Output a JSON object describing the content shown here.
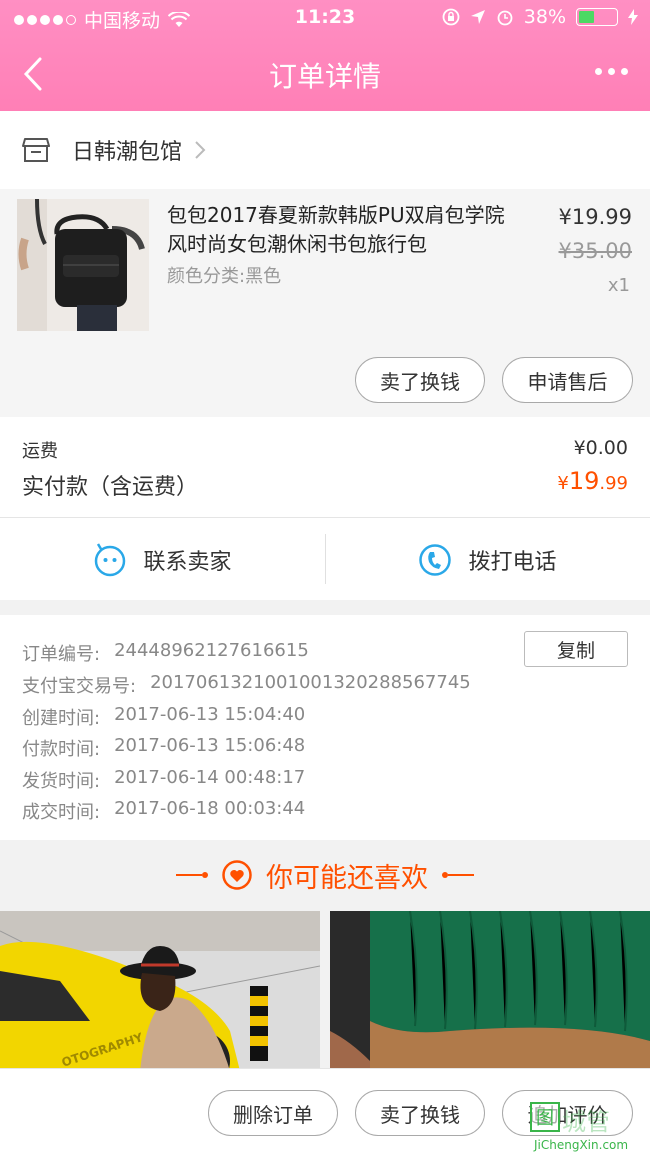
{
  "status_bar": {
    "carrier": "中国移动",
    "time": "11:23",
    "battery": "38%",
    "battery_level": 0.38
  },
  "nav": {
    "title": "订单详情"
  },
  "shop": {
    "name": "日韩潮包馆"
  },
  "product": {
    "name": "包包2017春夏新款韩版PU双肩包学院风时尚女包潮休闲书包旅行包",
    "spec": "颜色分类:黑色",
    "price": "¥19.99",
    "original_price": "¥35.00",
    "quantity": "x1",
    "sell_button": "卖了换钱",
    "after_sale_button": "申请售后"
  },
  "fees": {
    "shipping_label": "运费",
    "shipping_value": "¥0.00",
    "paid_label": "实付款（含运费）",
    "paid_currency": "¥",
    "paid_int": "19",
    "paid_dec": ".99"
  },
  "contact": {
    "seller_label": "联系卖家",
    "call_label": "拨打电话"
  },
  "order_info": {
    "copy_button": "复制",
    "rows": [
      {
        "label": "订单编号:",
        "value": "24448962127616615"
      },
      {
        "label": "支付宝交易号:",
        "value": "2017061321001001320288567745"
      },
      {
        "label": "创建时间:",
        "value": "2017-06-13 15:04:40"
      },
      {
        "label": "付款时间:",
        "value": "2017-06-13 15:06:48"
      },
      {
        "label": "发货时间:",
        "value": "2017-06-14 00:48:17"
      },
      {
        "label": "成交时间:",
        "value": "2017-06-18 00:03:44"
      }
    ]
  },
  "recommend": {
    "title": "你可能还喜欢",
    "image1_text": "OTOGRAPHY"
  },
  "bottom_bar": {
    "delete_button": "删除订单",
    "sell_button": "卖了换钱",
    "review_button": "追加评价"
  },
  "watermark": {
    "logo": "图",
    "text": "城管",
    "url": "JiChengXin.com"
  },
  "colors": {
    "header": "#ff85bb",
    "accent": "#ff5000",
    "contact_icon": "#2aa8e8"
  }
}
